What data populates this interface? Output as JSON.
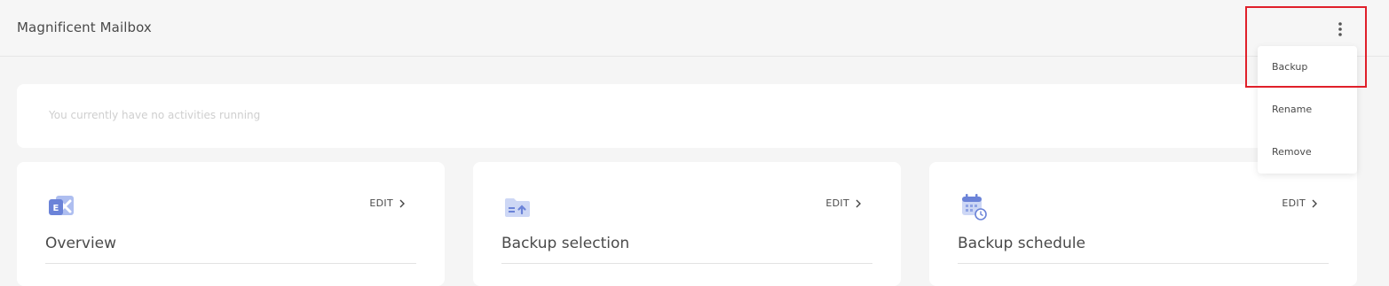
{
  "header": {
    "title": "Magnificent Mailbox",
    "more_icon": "kebab-vertical-icon"
  },
  "activity": {
    "message": "You currently have no activities running"
  },
  "cards": [
    {
      "title": "Overview",
      "edit_label": "EDIT",
      "icon": "exchange-icon"
    },
    {
      "title": "Backup selection",
      "edit_label": "EDIT",
      "icon": "folder-upload-icon"
    },
    {
      "title": "Backup schedule",
      "edit_label": "EDIT",
      "icon": "calendar-clock-icon"
    }
  ],
  "menu": {
    "items": [
      {
        "label": "Backup"
      },
      {
        "label": "Rename"
      },
      {
        "label": "Remove"
      }
    ]
  },
  "colors": {
    "background": "#f5f5f5",
    "card": "#ffffff",
    "icon_accent": "#6b83d8",
    "highlight": "#e0202a"
  }
}
